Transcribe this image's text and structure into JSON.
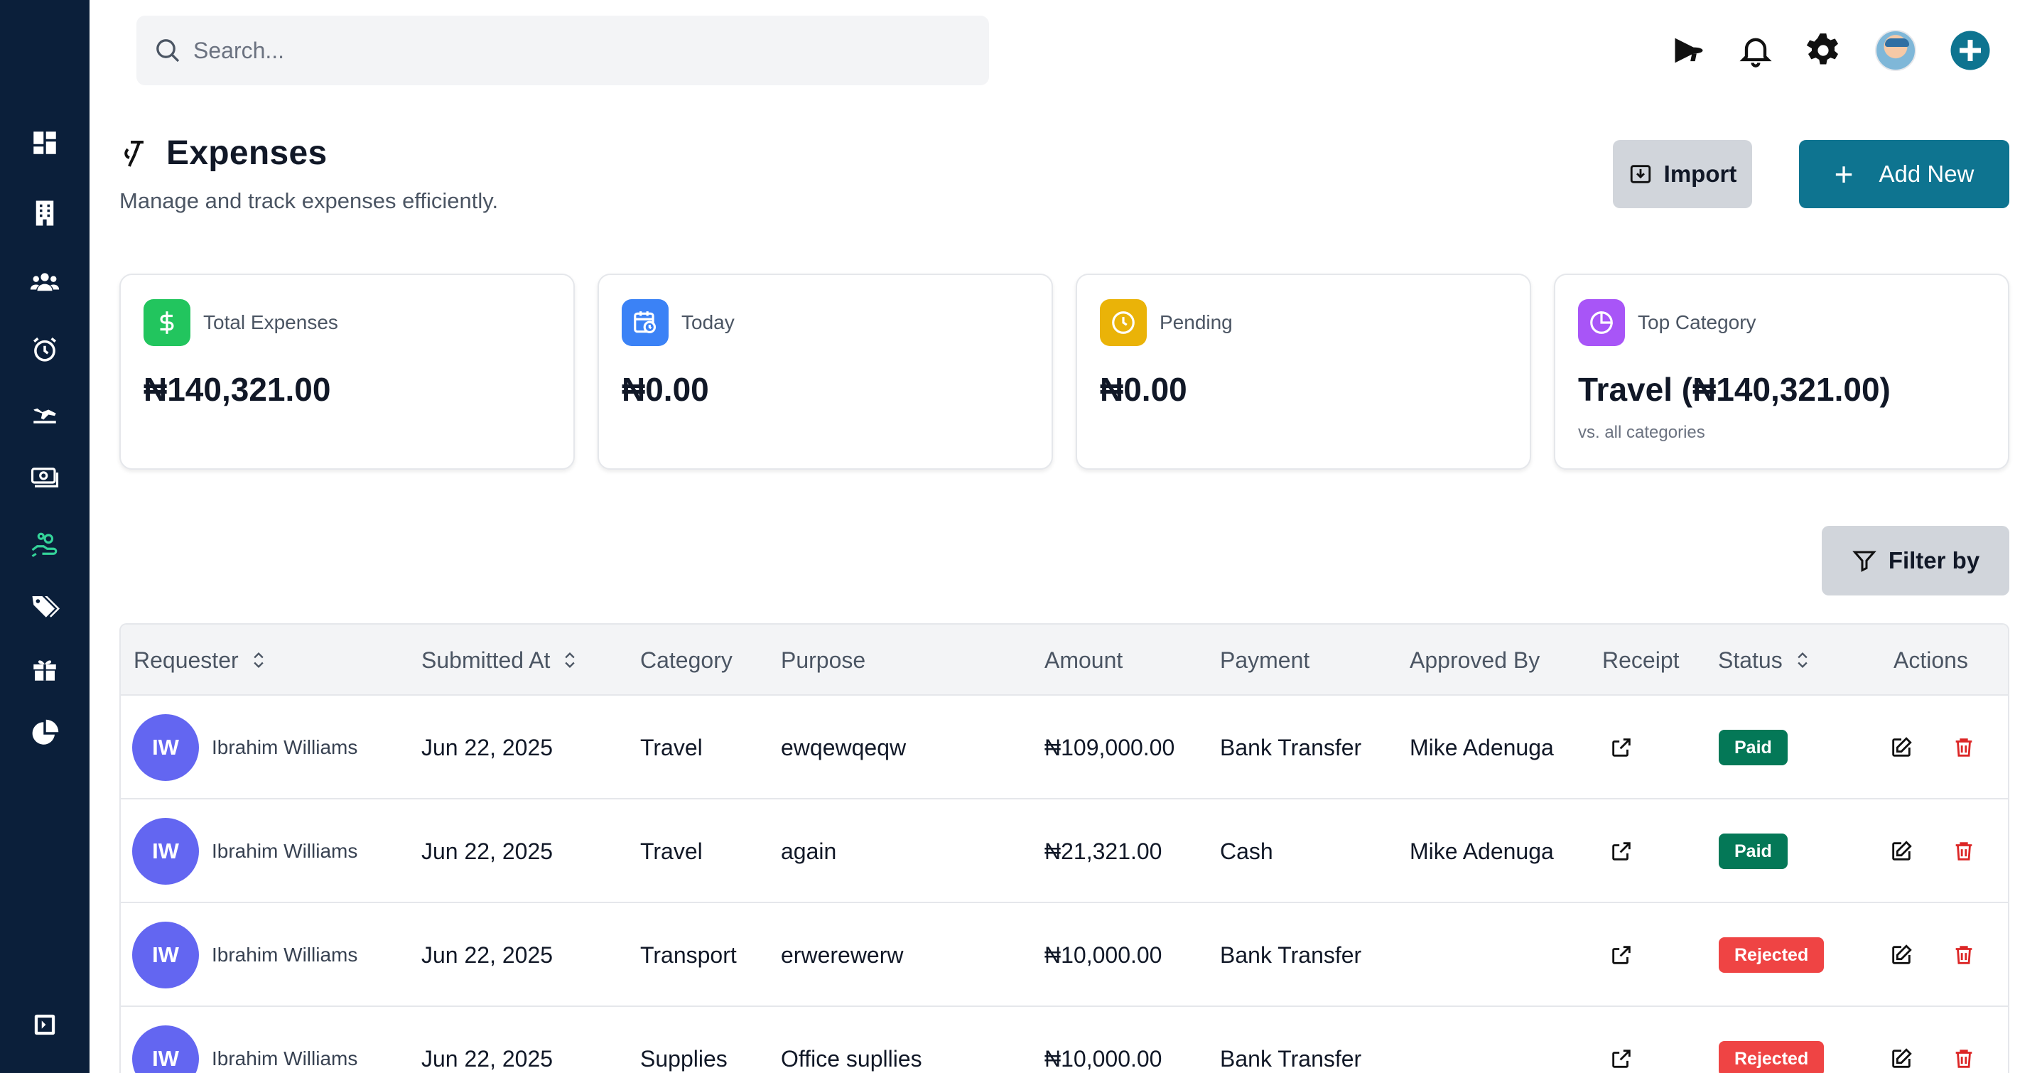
{
  "search": {
    "placeholder": "Search..."
  },
  "sidebar": {
    "items": [
      {
        "icon": "dashboard-icon"
      },
      {
        "icon": "building-icon"
      },
      {
        "icon": "users-icon"
      },
      {
        "icon": "alarm-clock-icon"
      },
      {
        "icon": "plane-icon"
      },
      {
        "icon": "money-icon"
      },
      {
        "icon": "hand-coins-icon",
        "active": true
      },
      {
        "icon": "tags-icon"
      },
      {
        "icon": "gift-icon"
      },
      {
        "icon": "pie-chart-icon"
      }
    ],
    "collapse_icon": "sidebar-toggle-icon",
    "active_color": "#34d399"
  },
  "header": {
    "title": "Expenses",
    "subtitle": "Manage and track expenses efficiently.",
    "import_label": "Import",
    "add_label": "Add New",
    "add_plus": "+"
  },
  "colors": {
    "primary": "#0e7490",
    "paid": "#047857",
    "rejected": "#ef4444",
    "avatar": "#6366f1"
  },
  "stats": [
    {
      "label": "Total Expenses",
      "value": "₦140,321.00",
      "icon": "dollar-icon",
      "color": "#22c55e"
    },
    {
      "label": "Today",
      "value": "₦0.00",
      "icon": "calendar-clock-icon",
      "color": "#3b82f6"
    },
    {
      "label": "Pending",
      "value": "₦0.00",
      "icon": "clock-icon",
      "color": "#eab308"
    },
    {
      "label": "Top Category",
      "value": "Travel (₦140,321.00)",
      "note": "vs. all categories",
      "icon": "pie-icon",
      "color": "#a855f7"
    }
  ],
  "filter": {
    "label": "Filter by"
  },
  "table": {
    "columns": [
      "Requester",
      "Submitted At",
      "Category",
      "Purpose",
      "Amount",
      "Payment",
      "Approved By",
      "Receipt",
      "Status",
      "Actions"
    ],
    "rows": [
      {
        "initials": "IW",
        "requester": "Ibrahim Williams",
        "submitted": "Jun 22, 2025",
        "category": "Travel",
        "purpose": "ewqewqeqw",
        "amount": "₦109,000.00",
        "payment": "Bank Transfer",
        "approved_by": "Mike Adenuga",
        "status": "Paid"
      },
      {
        "initials": "IW",
        "requester": "Ibrahim Williams",
        "submitted": "Jun 22, 2025",
        "category": "Travel",
        "purpose": "again",
        "amount": "₦21,321.00",
        "payment": "Cash",
        "approved_by": "Mike Adenuga",
        "status": "Paid"
      },
      {
        "initials": "IW",
        "requester": "Ibrahim Williams",
        "submitted": "Jun 22, 2025",
        "category": "Transport",
        "purpose": "erwerewerw",
        "amount": "₦10,000.00",
        "payment": "Bank Transfer",
        "approved_by": "",
        "status": "Rejected"
      },
      {
        "initials": "IW",
        "requester": "Ibrahim Williams",
        "submitted": "Jun 22, 2025",
        "category": "Supplies",
        "purpose": "Office supllies",
        "amount": "₦10,000.00",
        "payment": "Bank Transfer",
        "approved_by": "",
        "status": "Rejected"
      }
    ]
  }
}
